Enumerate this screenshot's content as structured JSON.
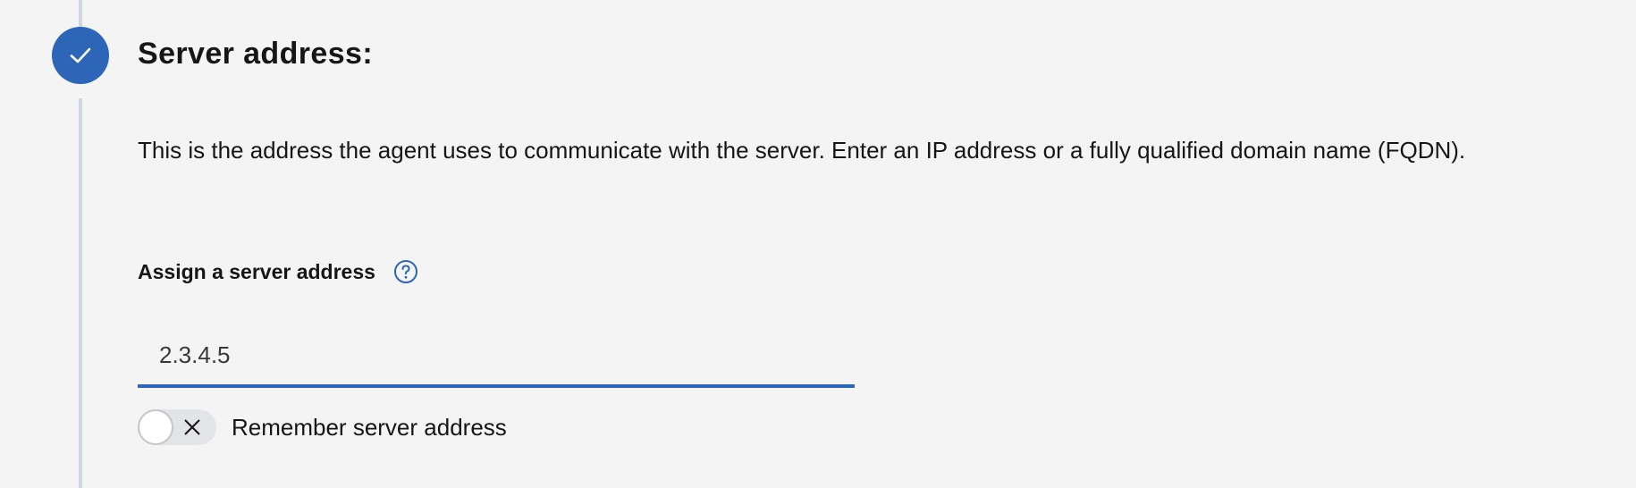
{
  "step": {
    "title": "Server address:",
    "status_icon": "checkmark-icon",
    "accent_color": "#2d66b6"
  },
  "description": "This is the address the agent uses to communicate with the server. Enter an IP address or a fully qualified domain name (FQDN).",
  "field": {
    "label": "Assign a server address",
    "help_icon": "question-circle-icon",
    "value": "2.3.4.5"
  },
  "toggle": {
    "label": "Remember server address",
    "state": "off",
    "icon": "close-icon"
  }
}
